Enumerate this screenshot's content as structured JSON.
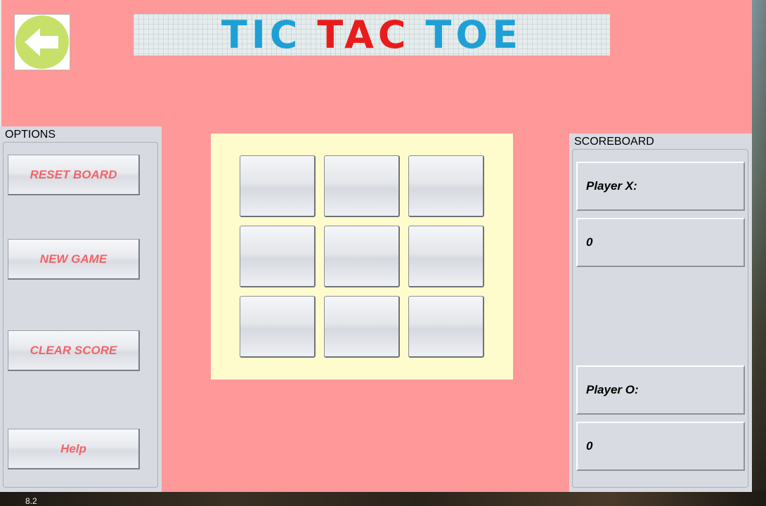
{
  "app": {
    "title_words": [
      "TIC",
      "TAC",
      "TOE"
    ],
    "colors": {
      "background": "#ff9898",
      "panel": "#d7dae1",
      "board": "#fefccd",
      "button_text": "#f06468",
      "back_circle": "#c6e06a",
      "title_blue": "#1ea0d6",
      "title_red": "#e81c1c"
    }
  },
  "back_button": {
    "icon": "arrow-left-icon"
  },
  "options": {
    "title": "OPTIONS",
    "buttons": [
      {
        "label": "RESET BOARD"
      },
      {
        "label": "NEW GAME"
      },
      {
        "label": "CLEAR SCORE"
      },
      {
        "label": "Help"
      }
    ]
  },
  "board": {
    "cells": [
      "",
      "",
      "",
      "",
      "",
      "",
      "",
      "",
      ""
    ]
  },
  "scoreboard": {
    "title": "SCOREBOARD",
    "player_x": {
      "label": "Player X:",
      "score": "0"
    },
    "player_o": {
      "label": "Player O:",
      "score": "0"
    }
  },
  "desktop": {
    "label": "8.2"
  }
}
